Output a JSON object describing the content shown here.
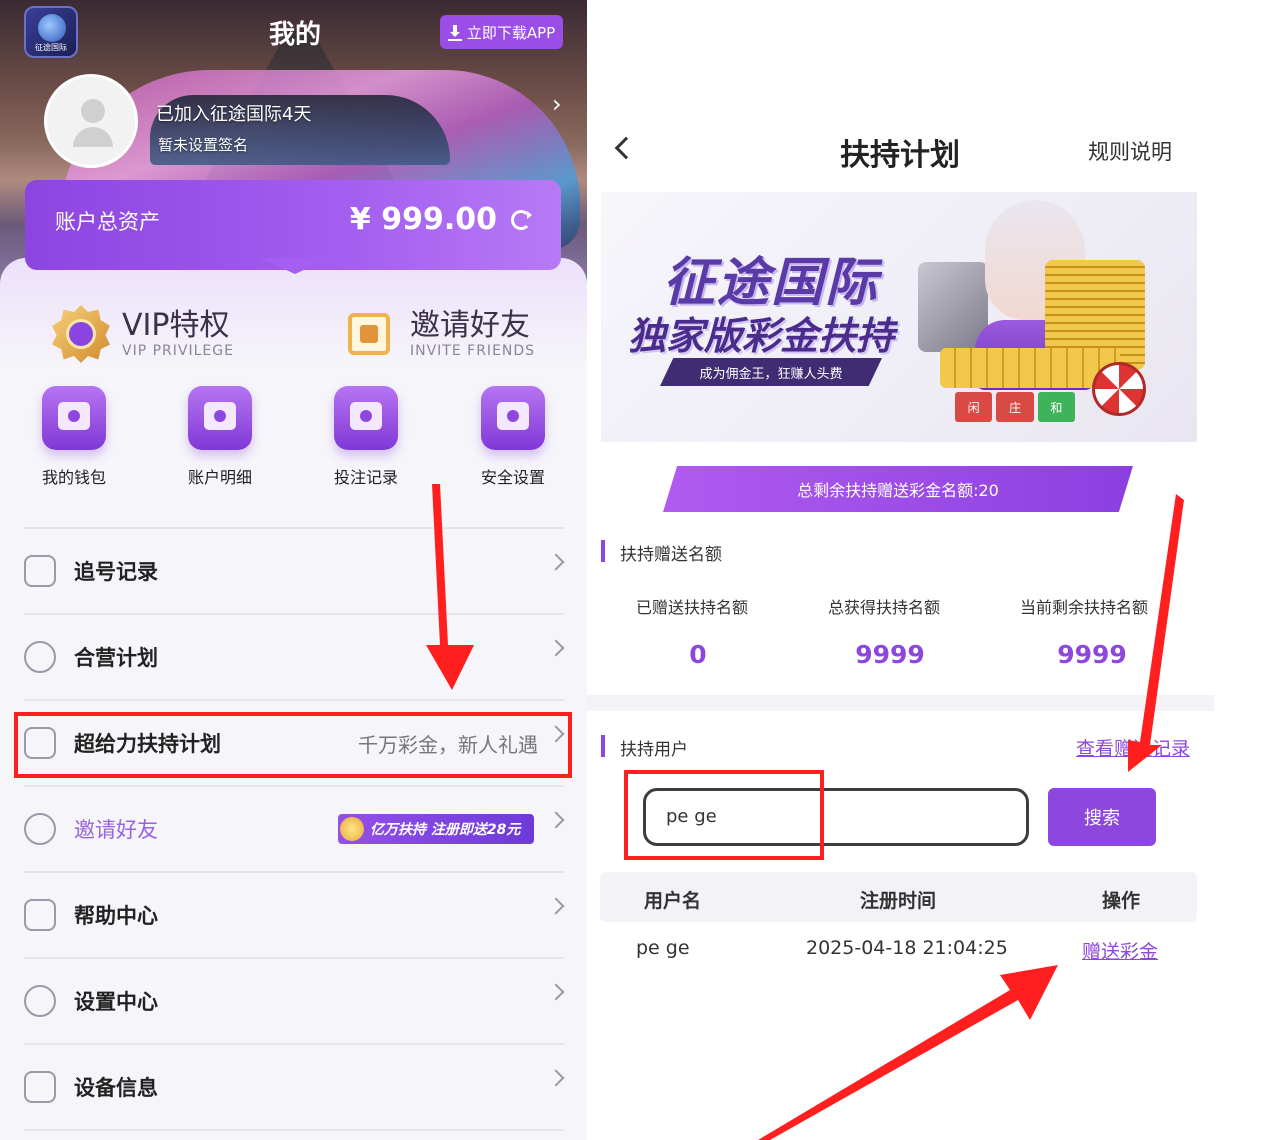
{
  "left": {
    "header": {
      "logo_text": "征途国际",
      "title": "我的",
      "download_label": "立即下载APP"
    },
    "profile": {
      "joined_text": "已加入征途国际4天",
      "signature": "暂未设置签名"
    },
    "asset": {
      "label": "账户总资产",
      "value": "¥ 999.00"
    },
    "features": [
      {
        "title": "VIP特权",
        "subtitle": "VIP PRIVILEGE"
      },
      {
        "title": "邀请好友",
        "subtitle": "INVITE FRIENDS"
      }
    ],
    "quick_actions": [
      {
        "label": "我的钱包",
        "icon": "wallet-icon"
      },
      {
        "label": "账户明细",
        "icon": "receipt-icon"
      },
      {
        "label": "投注记录",
        "icon": "bet-record-icon"
      },
      {
        "label": "安全设置",
        "icon": "shield-icon"
      }
    ],
    "menu": [
      {
        "label": "追号记录",
        "extra": "",
        "icon": "search-record-icon"
      },
      {
        "label": "合营计划",
        "extra": "",
        "icon": "handshake-icon"
      },
      {
        "label": "超给力扶持计划",
        "extra": "千万彩金，新人礼遇",
        "icon": "gift-icon"
      },
      {
        "label": "邀请好友",
        "extra": "",
        "icon": "users-icon",
        "badge": "亿万扶持 注册即送28元"
      },
      {
        "label": "帮助中心",
        "extra": "",
        "icon": "help-icon"
      },
      {
        "label": "设置中心",
        "extra": "",
        "icon": "gear-icon"
      },
      {
        "label": "设备信息",
        "extra": "",
        "icon": "device-icon"
      }
    ]
  },
  "right": {
    "header": {
      "title": "扶持计划",
      "rules_label": "规则说明"
    },
    "banner": {
      "title": "征途国际",
      "subtitle": "独家版彩金扶持",
      "ribbon": "成为佣金王，狂赚人头费",
      "chips": [
        "闲",
        "庄",
        "和"
      ]
    },
    "quota_text": "总剩余扶持赠送彩金名额:20",
    "stats_section_title": "扶持赠送名额",
    "stats": [
      {
        "label": "已赠送扶持名额",
        "value": "0"
      },
      {
        "label": "总获得扶持名额",
        "value": "9999"
      },
      {
        "label": "当前剩余扶持名额",
        "value": "9999"
      }
    ],
    "users_section_title": "扶持用户",
    "view_records_label": "查看赠送记录",
    "search": {
      "value": "pe   ge",
      "button_label": "搜索"
    },
    "table": {
      "headers": [
        "用户名",
        "注册时间",
        "操作"
      ],
      "rows": [
        {
          "username": "pe   ge",
          "registered": "2025-04-18 21:04:25",
          "action": "赠送彩金"
        }
      ]
    }
  },
  "colors": {
    "accent": "#8d47df",
    "annotation_red": "#ff1f1f"
  }
}
